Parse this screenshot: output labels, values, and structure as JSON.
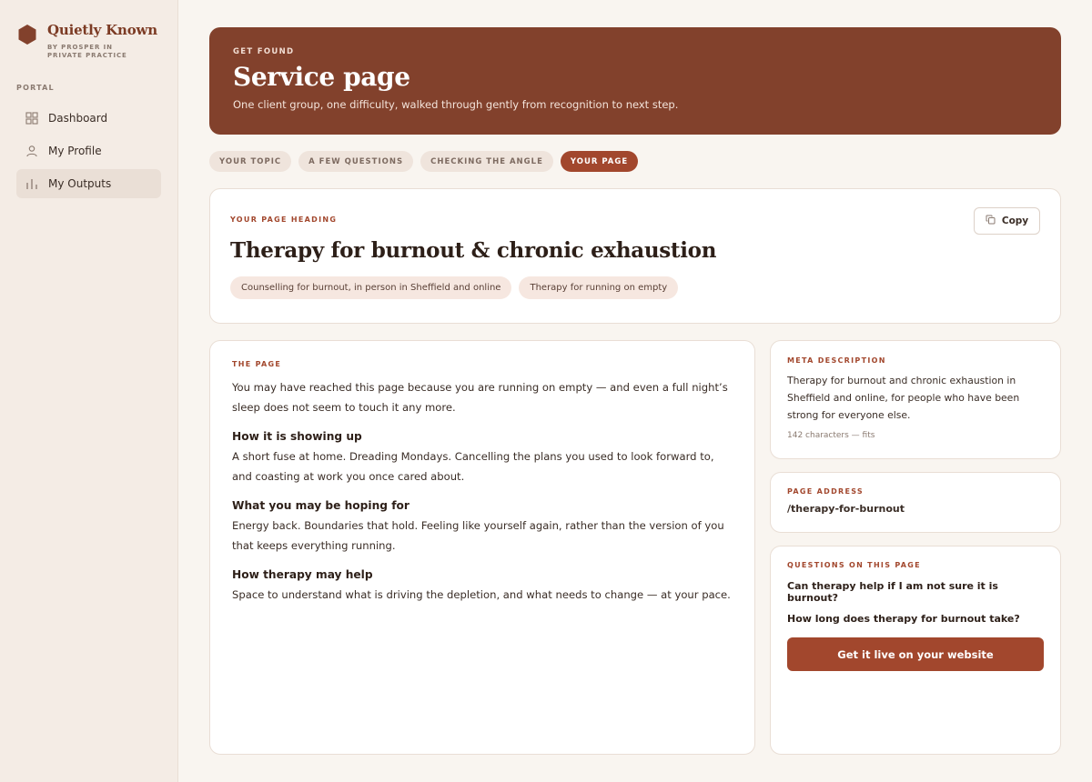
{
  "brand": {
    "name": "Quietly Known",
    "sub": "BY PROSPER IN PRIVATE PRACTICE"
  },
  "sidebar": {
    "section": "PORTAL",
    "items": [
      {
        "label": "Dashboard",
        "icon": "grid-icon"
      },
      {
        "label": "My Profile",
        "icon": "user-icon"
      },
      {
        "label": "My Outputs",
        "icon": "bar-chart-icon",
        "active": true
      }
    ]
  },
  "hero": {
    "eyebrow": "GET FOUND",
    "title": "Service page",
    "subtitle": "One client group, one difficulty, walked through gently from recognition to next step."
  },
  "steps": [
    "YOUR TOPIC",
    "A FEW QUESTIONS",
    "CHECKING THE ANGLE",
    "YOUR PAGE"
  ],
  "heading_card": {
    "eyebrow": "YOUR PAGE HEADING",
    "copy_label": "Copy",
    "heading": "Therapy for burnout & chronic exhaustion",
    "tags": [
      "Counselling for burnout, in person in Sheffield and online",
      "Therapy for running on empty"
    ]
  },
  "page": {
    "eyebrow": "THE PAGE",
    "intro": "You may have reached this page because you are running on empty — and even a full night’s sleep does not seem to touch it any more.",
    "sections": [
      {
        "heading": "How it is showing up",
        "body": "A short fuse at home. Dreading Mondays. Cancelling the plans you used to look forward to, and coasting at work you once cared about."
      },
      {
        "heading": "What you may be hoping for",
        "body": "Energy back. Boundaries that hold. Feeling like yourself again, rather than the version of you that keeps everything running."
      },
      {
        "heading": "How therapy may help",
        "body": "Space to understand what is driving the depletion, and what needs to change — at your pace."
      }
    ]
  },
  "meta": {
    "eyebrow": "META DESCRIPTION",
    "text": "Therapy for burnout and chronic exhaustion in Sheffield and online, for people who have been strong for everyone else.",
    "count": "142 characters — fits"
  },
  "address": {
    "eyebrow": "PAGE ADDRESS",
    "value": "/therapy-for-burnout"
  },
  "questions": {
    "eyebrow": "QUESTIONS ON THIS PAGE",
    "items": [
      "Can therapy help if I am not sure it is burnout?",
      "How long does therapy for burnout take?"
    ],
    "cta": "Get it live on your website"
  },
  "colors": {
    "accent": "#a2472d",
    "hero": "#82412c",
    "sidebar": "#f4ece5",
    "background": "#f9f5f0"
  }
}
